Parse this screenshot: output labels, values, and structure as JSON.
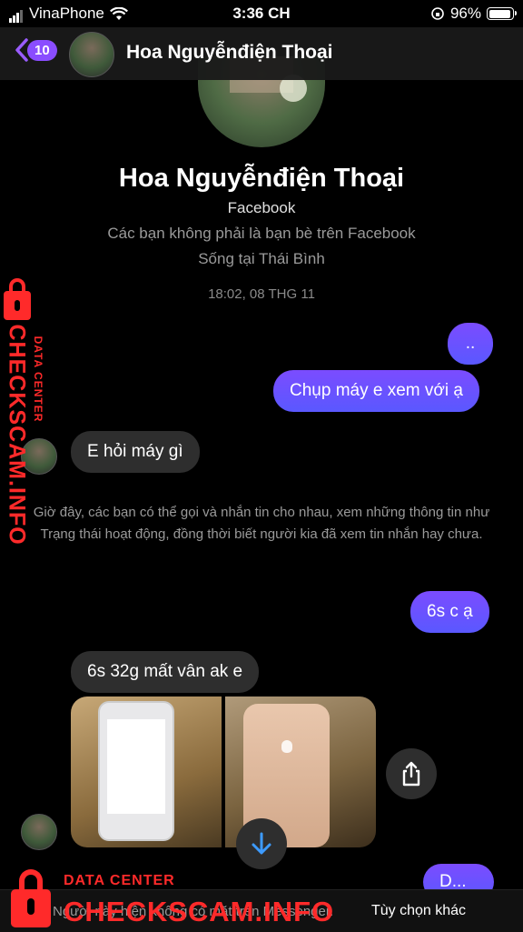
{
  "status_bar": {
    "carrier": "VinaPhone",
    "time": "3:36 CH",
    "battery": "96%"
  },
  "header": {
    "back_count": "10",
    "contact_name": "Hoa Nguyễnđiện Thoại"
  },
  "profile": {
    "name": "Hoa Nguyễnđiện Thoại",
    "platform": "Facebook",
    "friend_status": "Các bạn không phải là bạn bè trên Facebook",
    "location": "Sống tại Thái Bình"
  },
  "conversation": {
    "timestamp": "18:02, 08 THG 11",
    "messages": [
      {
        "direction": "out",
        "text": ".."
      },
      {
        "direction": "out",
        "text": "Chụp máy e xem với ạ"
      },
      {
        "direction": "in",
        "text": "E hỏi máy gì"
      },
      {
        "direction": "out",
        "text": "6s c ạ"
      },
      {
        "direction": "in",
        "text": "6s 32g mất vân ak e"
      }
    ],
    "notice": "Giờ đây, các bạn có thể gọi và nhắn tin cho nhau, xem những thông tin như Trạng thái hoạt động, đồng thời biết người kia đã xem tin nhắn hay chưa.",
    "partial_last_message": "D..."
  },
  "bottom_bar": {
    "info_text": "Người này hiện không có mặt trên Messenger.",
    "action": "Tùy chọn khác"
  },
  "watermark": {
    "side_title": "CHECKSCAM.INFO",
    "side_subtitle": "DATA CENTER",
    "bottom_subtitle": "DATA CENTER",
    "bottom_title": "CHECKSCAM.INFO"
  },
  "colors": {
    "outgoing_bubble": "#6a4dff",
    "incoming_bubble": "#2e2e2e",
    "accent": "#8a4dff",
    "watermark": "#ff2a2a"
  }
}
